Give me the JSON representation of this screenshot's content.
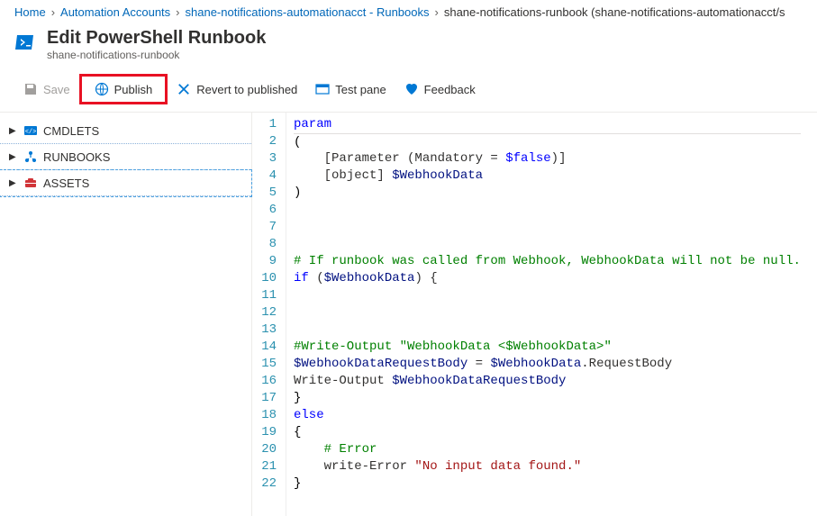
{
  "breadcrumb": {
    "items": [
      "Home",
      "Automation Accounts",
      "shane-notifications-automationacct - Runbooks",
      "shane-notifications-runbook (shane-notifications-automationacct/s"
    ]
  },
  "header": {
    "title": "Edit PowerShell Runbook",
    "subtitle": "shane-notifications-runbook"
  },
  "toolbar": {
    "save": "Save",
    "publish": "Publish",
    "revert": "Revert to published",
    "testpane": "Test pane",
    "feedback": "Feedback"
  },
  "sidebar": {
    "items": [
      {
        "label": "CMDLETS",
        "icon": "cmdlets"
      },
      {
        "label": "RUNBOOKS",
        "icon": "runbooks"
      },
      {
        "label": "ASSETS",
        "icon": "assets"
      }
    ]
  },
  "code": {
    "lines": [
      [
        [
          "kw",
          "param"
        ]
      ],
      [
        [
          "punc",
          "("
        ]
      ],
      [
        [
          "plain",
          "    [Parameter (Mandatory = "
        ],
        [
          "kw",
          "$false"
        ],
        [
          "plain",
          ")]"
        ]
      ],
      [
        [
          "plain",
          "    [object] "
        ],
        [
          "var",
          "$WebhookData"
        ]
      ],
      [
        [
          "punc",
          ")"
        ]
      ],
      [
        [
          "plain",
          ""
        ]
      ],
      [
        [
          "plain",
          ""
        ]
      ],
      [
        [
          "plain",
          ""
        ]
      ],
      [
        [
          "comment",
          "# If runbook was called from Webhook, WebhookData will not be null."
        ]
      ],
      [
        [
          "kw",
          "if"
        ],
        [
          "plain",
          " ("
        ],
        [
          "var",
          "$WebhookData"
        ],
        [
          "plain",
          ") {"
        ]
      ],
      [
        [
          "plain",
          ""
        ]
      ],
      [
        [
          "plain",
          ""
        ]
      ],
      [
        [
          "plain",
          ""
        ]
      ],
      [
        [
          "comment",
          "#Write-Output \"WebhookData <$WebhookData>\""
        ]
      ],
      [
        [
          "var",
          "$WebhookDataRequestBody"
        ],
        [
          "plain",
          " = "
        ],
        [
          "var",
          "$WebhookData"
        ],
        [
          "plain",
          ".RequestBody"
        ]
      ],
      [
        [
          "plain",
          "Write-Output "
        ],
        [
          "var",
          "$WebhookDataRequestBody"
        ]
      ],
      [
        [
          "punc",
          "}"
        ]
      ],
      [
        [
          "kw",
          "else"
        ]
      ],
      [
        [
          "punc",
          "{"
        ]
      ],
      [
        [
          "plain",
          "    "
        ],
        [
          "comment",
          "# Error"
        ]
      ],
      [
        [
          "plain",
          "    write-Error "
        ],
        [
          "str",
          "\"No input data found.\""
        ]
      ],
      [
        [
          "punc",
          "}"
        ]
      ]
    ]
  }
}
